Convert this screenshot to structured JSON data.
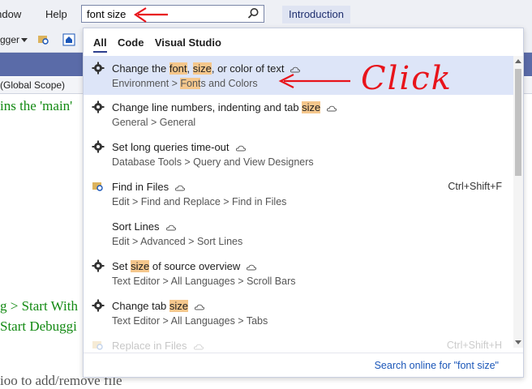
{
  "menubar": {
    "window_label": "Window",
    "help_label": "Help"
  },
  "search": {
    "query": "font size",
    "icon": "search-icon"
  },
  "introduction_label": "Introduction",
  "toolbar": {
    "debugger_label": "gger"
  },
  "scope": {
    "label": "(Global Scope)"
  },
  "code_lines": [
    "ins the 'main'",
    "g > Start With",
    "Start Debuggi",
    "ioo to add/remove file"
  ],
  "flyout": {
    "filters": [
      {
        "label": "All",
        "active": true
      },
      {
        "label": "Code",
        "active": false
      },
      {
        "label": "Visual Studio",
        "active": false
      }
    ],
    "results": [
      {
        "icon": "gear-icon",
        "title_parts": [
          "Change the ",
          "font",
          ", ",
          "size",
          ", or color of text"
        ],
        "path_parts": [
          "Environment > ",
          "Font",
          "s and Colors"
        ],
        "selected": true,
        "cloud": true
      },
      {
        "icon": "gear-icon",
        "title_parts": [
          "Change line numbers, indenting and tab ",
          "size",
          ""
        ],
        "path": "General > General",
        "cloud": true
      },
      {
        "icon": "gear-icon",
        "title": "Set long queries time-out",
        "path": "Database Tools > Query and View Designers",
        "cloud": true
      },
      {
        "icon": "find-in-files-icon",
        "title": "Find in Files",
        "path": "Edit > Find and Replace > Find in Files",
        "shortcut": "Ctrl+Shift+F",
        "cloud": true
      },
      {
        "icon": "none",
        "title": "Sort Lines",
        "path": "Edit > Advanced > Sort Lines",
        "cloud": true
      },
      {
        "icon": "gear-icon",
        "title_parts": [
          "Set ",
          "size",
          " of source overview"
        ],
        "path": "Text Editor > All Languages > Scroll Bars",
        "cloud": true
      },
      {
        "icon": "gear-icon",
        "title_parts": [
          "Change tab ",
          "size",
          ""
        ],
        "path": "Text Editor > All Languages > Tabs",
        "cloud": true
      },
      {
        "icon": "find-in-files-icon",
        "title": "Replace in Files",
        "shortcut": "Ctrl+Shift+H",
        "faded": true
      }
    ],
    "search_online": "Search online for \"font size\""
  },
  "annotation": {
    "text": "Click",
    "color": "#e8141b"
  },
  "colors": {
    "selected_bg": "#dde5f8",
    "highlight": "#f5c78c",
    "link": "#1a56b8",
    "code_green": "#138a13"
  }
}
